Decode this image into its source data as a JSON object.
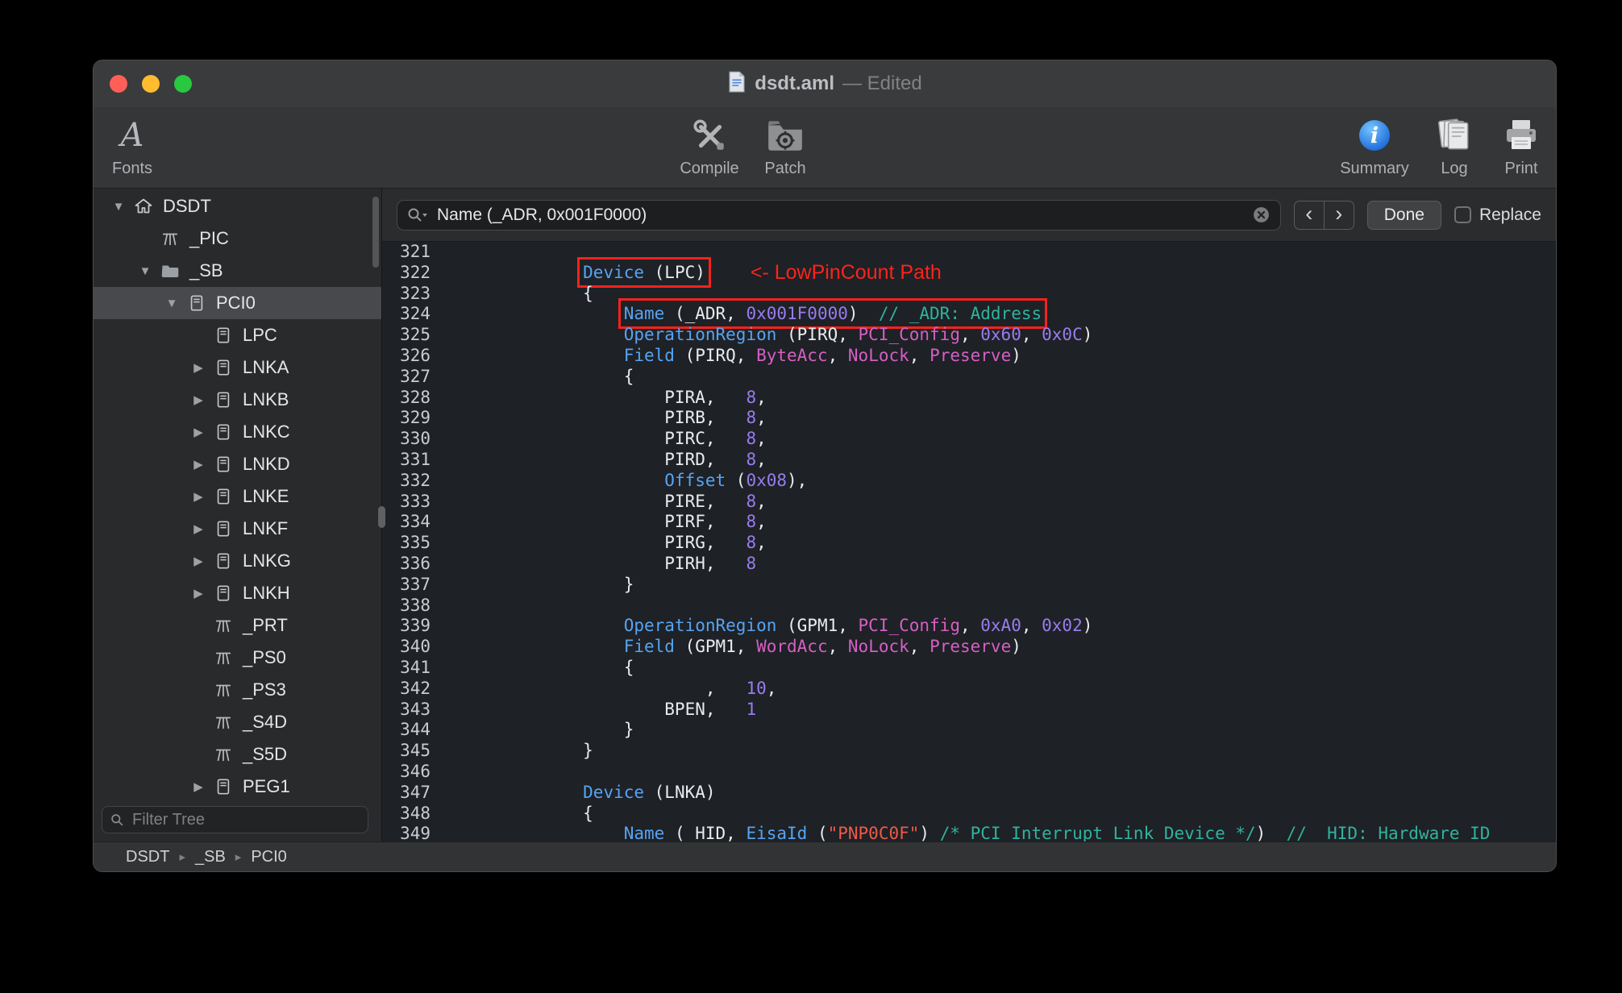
{
  "window": {
    "title": "dsdt.aml",
    "edited_suffix": "— Edited"
  },
  "toolbar": {
    "fonts_glyph": "A",
    "items": [
      {
        "label": "Fonts",
        "icon": "fonts-icon"
      },
      {
        "label": "Compile",
        "icon": "compile-icon"
      },
      {
        "label": "Patch",
        "icon": "patch-icon"
      },
      {
        "label": "Summary",
        "icon": "summary-icon"
      },
      {
        "label": "Log",
        "icon": "log-icon"
      },
      {
        "label": "Print",
        "icon": "print-icon"
      }
    ]
  },
  "sidebar": {
    "filter_placeholder": "Filter Tree",
    "items": [
      {
        "label": "DSDT",
        "level": 0,
        "icon": "house",
        "disclosure": "open",
        "selected": false
      },
      {
        "label": "_PIC",
        "level": 1,
        "icon": "method",
        "disclosure": "none",
        "selected": false
      },
      {
        "label": "_SB",
        "level": 1,
        "icon": "folder",
        "disclosure": "open",
        "selected": false
      },
      {
        "label": "PCI0",
        "level": 2,
        "icon": "device",
        "disclosure": "open",
        "selected": true
      },
      {
        "label": "LPC",
        "level": 3,
        "icon": "device",
        "disclosure": "none",
        "selected": false
      },
      {
        "label": "LNKA",
        "level": 3,
        "icon": "device",
        "disclosure": "closed",
        "selected": false
      },
      {
        "label": "LNKB",
        "level": 3,
        "icon": "device",
        "disclosure": "closed",
        "selected": false
      },
      {
        "label": "LNKC",
        "level": 3,
        "icon": "device",
        "disclosure": "closed",
        "selected": false
      },
      {
        "label": "LNKD",
        "level": 3,
        "icon": "device",
        "disclosure": "closed",
        "selected": false
      },
      {
        "label": "LNKE",
        "level": 3,
        "icon": "device",
        "disclosure": "closed",
        "selected": false
      },
      {
        "label": "LNKF",
        "level": 3,
        "icon": "device",
        "disclosure": "closed",
        "selected": false
      },
      {
        "label": "LNKG",
        "level": 3,
        "icon": "device",
        "disclosure": "closed",
        "selected": false
      },
      {
        "label": "LNKH",
        "level": 3,
        "icon": "device",
        "disclosure": "closed",
        "selected": false
      },
      {
        "label": "_PRT",
        "level": 3,
        "icon": "method",
        "disclosure": "none",
        "selected": false
      },
      {
        "label": "_PS0",
        "level": 3,
        "icon": "method",
        "disclosure": "none",
        "selected": false
      },
      {
        "label": "_PS3",
        "level": 3,
        "icon": "method",
        "disclosure": "none",
        "selected": false
      },
      {
        "label": "_S4D",
        "level": 3,
        "icon": "method",
        "disclosure": "none",
        "selected": false
      },
      {
        "label": "_S5D",
        "level": 3,
        "icon": "method",
        "disclosure": "none",
        "selected": false
      },
      {
        "label": "PEG1",
        "level": 3,
        "icon": "device",
        "disclosure": "closed",
        "selected": false
      }
    ]
  },
  "findbar": {
    "query": "Name (_ADR, 0x001F0000)",
    "prev_icon": "‹",
    "next_icon": "›",
    "done_label": "Done",
    "replace_label": "Replace"
  },
  "statusbar": {
    "breadcrumb": [
      "DSDT",
      "_SB",
      "PCI0"
    ],
    "separator": "▸"
  },
  "colors": {
    "highlight_box": "#f3231c",
    "annotation": "#fb241b",
    "keyword": "#57a4f2",
    "type": "#d55fc3",
    "number": "#9a7cee",
    "comment": "#2fb39e",
    "string": "#ee5a48"
  },
  "editor": {
    "lines": [
      {
        "n": "321",
        "segs": []
      },
      {
        "n": "322",
        "segs": [
          {
            "t": "        ",
            "c": "w"
          },
          {
            "box": [
              {
                "t": "Device",
                "c": "k"
              },
              {
                "t": " (LPC)",
                "c": "w"
              }
            ]
          },
          {
            "t": "<- LowPinCount Path",
            "c": "a"
          }
        ]
      },
      {
        "n": "323",
        "segs": [
          {
            "t": "        {",
            "c": "w"
          }
        ]
      },
      {
        "n": "324",
        "segs": [
          {
            "t": "            ",
            "c": "w"
          },
          {
            "box": [
              {
                "t": "Name",
                "c": "k"
              },
              {
                "t": " (_ADR, ",
                "c": "w"
              },
              {
                "t": "0x001F0000",
                "c": "p"
              },
              {
                "t": ")  ",
                "c": "w"
              },
              {
                "t": "// _ADR: Address",
                "c": "c"
              }
            ]
          }
        ]
      },
      {
        "n": "325",
        "segs": [
          {
            "t": "            ",
            "c": "w"
          },
          {
            "t": "OperationRegion",
            "c": "k"
          },
          {
            "t": " (PIRQ, ",
            "c": "w"
          },
          {
            "t": "PCI_Config",
            "c": "m"
          },
          {
            "t": ", ",
            "c": "w"
          },
          {
            "t": "0x60",
            "c": "p"
          },
          {
            "t": ", ",
            "c": "w"
          },
          {
            "t": "0x0C",
            "c": "p"
          },
          {
            "t": ")",
            "c": "w"
          }
        ]
      },
      {
        "n": "326",
        "segs": [
          {
            "t": "            ",
            "c": "w"
          },
          {
            "t": "Field",
            "c": "k"
          },
          {
            "t": " (PIRQ, ",
            "c": "w"
          },
          {
            "t": "ByteAcc",
            "c": "m"
          },
          {
            "t": ", ",
            "c": "w"
          },
          {
            "t": "NoLock",
            "c": "m"
          },
          {
            "t": ", ",
            "c": "w"
          },
          {
            "t": "Preserve",
            "c": "m"
          },
          {
            "t": ")",
            "c": "w"
          }
        ]
      },
      {
        "n": "327",
        "segs": [
          {
            "t": "            {",
            "c": "w"
          }
        ]
      },
      {
        "n": "328",
        "segs": [
          {
            "t": "                PIRA,   ",
            "c": "w"
          },
          {
            "t": "8",
            "c": "p"
          },
          {
            "t": ",",
            "c": "w"
          }
        ]
      },
      {
        "n": "329",
        "segs": [
          {
            "t": "                PIRB,   ",
            "c": "w"
          },
          {
            "t": "8",
            "c": "p"
          },
          {
            "t": ",",
            "c": "w"
          }
        ]
      },
      {
        "n": "330",
        "segs": [
          {
            "t": "                PIRC,   ",
            "c": "w"
          },
          {
            "t": "8",
            "c": "p"
          },
          {
            "t": ",",
            "c": "w"
          }
        ]
      },
      {
        "n": "331",
        "segs": [
          {
            "t": "                PIRD,   ",
            "c": "w"
          },
          {
            "t": "8",
            "c": "p"
          },
          {
            "t": ",",
            "c": "w"
          }
        ]
      },
      {
        "n": "332",
        "segs": [
          {
            "t": "                ",
            "c": "w"
          },
          {
            "t": "Offset",
            "c": "k"
          },
          {
            "t": " (",
            "c": "w"
          },
          {
            "t": "0x08",
            "c": "p"
          },
          {
            "t": "),",
            "c": "w"
          }
        ]
      },
      {
        "n": "333",
        "segs": [
          {
            "t": "                PIRE,   ",
            "c": "w"
          },
          {
            "t": "8",
            "c": "p"
          },
          {
            "t": ",",
            "c": "w"
          }
        ]
      },
      {
        "n": "334",
        "segs": [
          {
            "t": "                PIRF,   ",
            "c": "w"
          },
          {
            "t": "8",
            "c": "p"
          },
          {
            "t": ",",
            "c": "w"
          }
        ]
      },
      {
        "n": "335",
        "segs": [
          {
            "t": "                PIRG,   ",
            "c": "w"
          },
          {
            "t": "8",
            "c": "p"
          },
          {
            "t": ",",
            "c": "w"
          }
        ]
      },
      {
        "n": "336",
        "segs": [
          {
            "t": "                PIRH,   ",
            "c": "w"
          },
          {
            "t": "8",
            "c": "p"
          }
        ]
      },
      {
        "n": "337",
        "segs": [
          {
            "t": "            }",
            "c": "w"
          }
        ]
      },
      {
        "n": "338",
        "segs": []
      },
      {
        "n": "339",
        "segs": [
          {
            "t": "            ",
            "c": "w"
          },
          {
            "t": "OperationRegion",
            "c": "k"
          },
          {
            "t": " (GPM1, ",
            "c": "w"
          },
          {
            "t": "PCI_Config",
            "c": "m"
          },
          {
            "t": ", ",
            "c": "w"
          },
          {
            "t": "0xA0",
            "c": "p"
          },
          {
            "t": ", ",
            "c": "w"
          },
          {
            "t": "0x02",
            "c": "p"
          },
          {
            "t": ")",
            "c": "w"
          }
        ]
      },
      {
        "n": "340",
        "segs": [
          {
            "t": "            ",
            "c": "w"
          },
          {
            "t": "Field",
            "c": "k"
          },
          {
            "t": " (GPM1, ",
            "c": "w"
          },
          {
            "t": "WordAcc",
            "c": "m"
          },
          {
            "t": ", ",
            "c": "w"
          },
          {
            "t": "NoLock",
            "c": "m"
          },
          {
            "t": ", ",
            "c": "w"
          },
          {
            "t": "Preserve",
            "c": "m"
          },
          {
            "t": ")",
            "c": "w"
          }
        ]
      },
      {
        "n": "341",
        "segs": [
          {
            "t": "            {",
            "c": "w"
          }
        ]
      },
      {
        "n": "342",
        "segs": [
          {
            "t": "                    ,   ",
            "c": "w"
          },
          {
            "t": "10",
            "c": "p"
          },
          {
            "t": ",",
            "c": "w"
          }
        ]
      },
      {
        "n": "343",
        "segs": [
          {
            "t": "                BPEN,   ",
            "c": "w"
          },
          {
            "t": "1",
            "c": "p"
          }
        ]
      },
      {
        "n": "344",
        "segs": [
          {
            "t": "            }",
            "c": "w"
          }
        ]
      },
      {
        "n": "345",
        "segs": [
          {
            "t": "        }",
            "c": "w"
          }
        ]
      },
      {
        "n": "346",
        "segs": []
      },
      {
        "n": "347",
        "segs": [
          {
            "t": "        ",
            "c": "w"
          },
          {
            "t": "Device",
            "c": "k"
          },
          {
            "t": " (LNKA)",
            "c": "w"
          }
        ]
      },
      {
        "n": "348",
        "segs": [
          {
            "t": "        {",
            "c": "w"
          }
        ]
      },
      {
        "n": "349",
        "segs": [
          {
            "t": "            ",
            "c": "w"
          },
          {
            "t": "Name",
            "c": "k"
          },
          {
            "t": " (_HID, ",
            "c": "w"
          },
          {
            "t": "EisaId",
            "c": "k"
          },
          {
            "t": " (",
            "c": "w"
          },
          {
            "t": "\"PNP0C0F\"",
            "c": "s"
          },
          {
            "t": ") ",
            "c": "w"
          },
          {
            "t": "/* PCI Interrupt Link Device */",
            "c": "c"
          },
          {
            "t": ")  ",
            "c": "w"
          },
          {
            "t": "// _HID: Hardware ID",
            "c": "c"
          }
        ]
      }
    ]
  }
}
